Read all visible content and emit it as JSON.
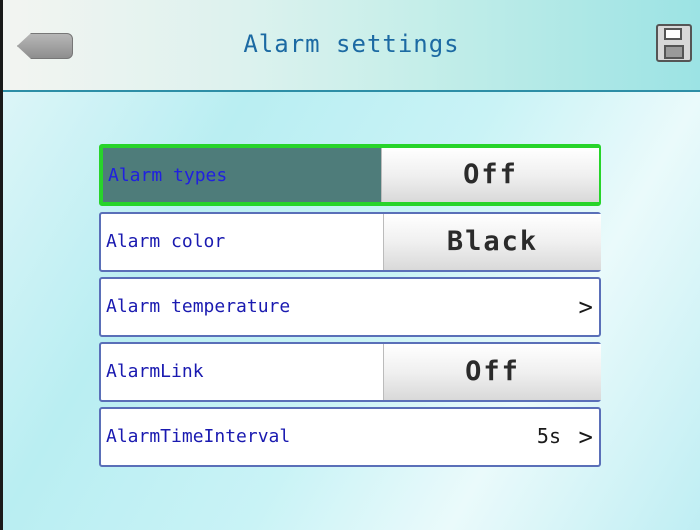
{
  "header": {
    "title": "Alarm settings",
    "back_icon": "back-arrow-icon",
    "save_icon": "floppy-disk-save-icon"
  },
  "settings": {
    "alarm_types": {
      "label": "Alarm types",
      "value": "Off"
    },
    "alarm_color": {
      "label": "Alarm color",
      "value": "Black"
    },
    "alarm_temperature": {
      "label": "Alarm temperature",
      "chevron": ">"
    },
    "alarm_link": {
      "label": "AlarmLink",
      "value": "Off"
    },
    "alarm_time_interval": {
      "label": "AlarmTimeInterval",
      "value": "5s",
      "chevron": ">"
    }
  },
  "colors": {
    "selected_border": "#27d42a",
    "selected_fill": "#4e7c7a",
    "label_text": "#1a1ab0",
    "title_text": "#1c6aa3"
  }
}
